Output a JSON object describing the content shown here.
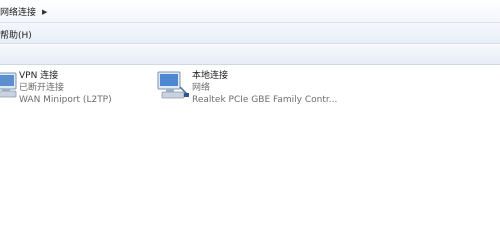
{
  "address_bar": {
    "path_label": "网络连接"
  },
  "menu": {
    "help_label": "帮助(H)"
  },
  "connections": [
    {
      "name": "VPN 连接",
      "status": "已断开连接",
      "device": "WAN Miniport (L2TP)",
      "icon": "vpn-connection-icon"
    },
    {
      "name": "本地连接",
      "status": "网络",
      "device": "Realtek PCIe GBE Family Contr...",
      "icon": "local-connection-icon"
    }
  ]
}
